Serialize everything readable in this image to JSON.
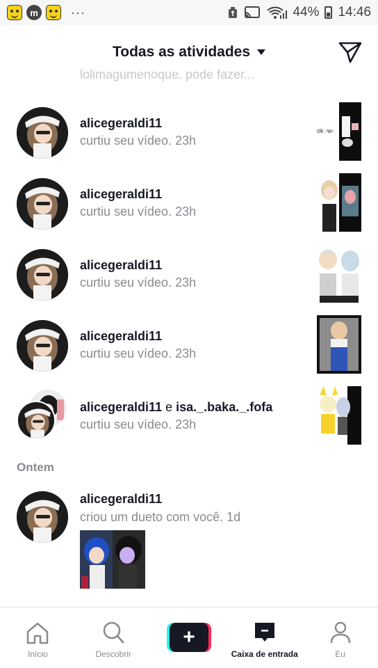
{
  "status_bar": {
    "wifi_icon": "wifi-icon",
    "signal_icon": "signal-icon",
    "battery": "44%",
    "time": "14:46",
    "dots": "···"
  },
  "header": {
    "title": "Todas as atividades",
    "send_icon": "send-icon"
  },
  "cutoff_text": "lolimagumenoque. pode fazer...",
  "notifications": [
    {
      "user": "alicegeraldi11",
      "action": "curtiu seu vídeo.",
      "time": "23h"
    },
    {
      "user": "alicegeraldi11",
      "action": "curtiu seu vídeo.",
      "time": "23h"
    },
    {
      "user": "alicegeraldi11",
      "action": "curtiu seu vídeo.",
      "time": "23h"
    },
    {
      "user": "alicegeraldi11",
      "action": "curtiu seu vídeo.",
      "time": "23h"
    },
    {
      "user": "alicegeraldi11",
      "joiner": "e",
      "user2": "isa._.baka._.fofa",
      "action": "curtiu seu vídeo.",
      "time": "23h"
    }
  ],
  "section_yesterday": "Ontem",
  "duet": {
    "user": "alicegeraldi11",
    "action": "criou um dueto com você.",
    "time": "1d"
  },
  "thumb1_text": "ok -w-",
  "bottom_nav": {
    "home": "Início",
    "discover": "Descobrir",
    "create": "+",
    "inbox": "Caixa de entrada",
    "me": "Eu"
  },
  "colors": {
    "accent_cyan": "#25f4ee",
    "accent_red": "#fe2c55",
    "primary_text": "#161823",
    "secondary_text": "#8a8b91"
  }
}
